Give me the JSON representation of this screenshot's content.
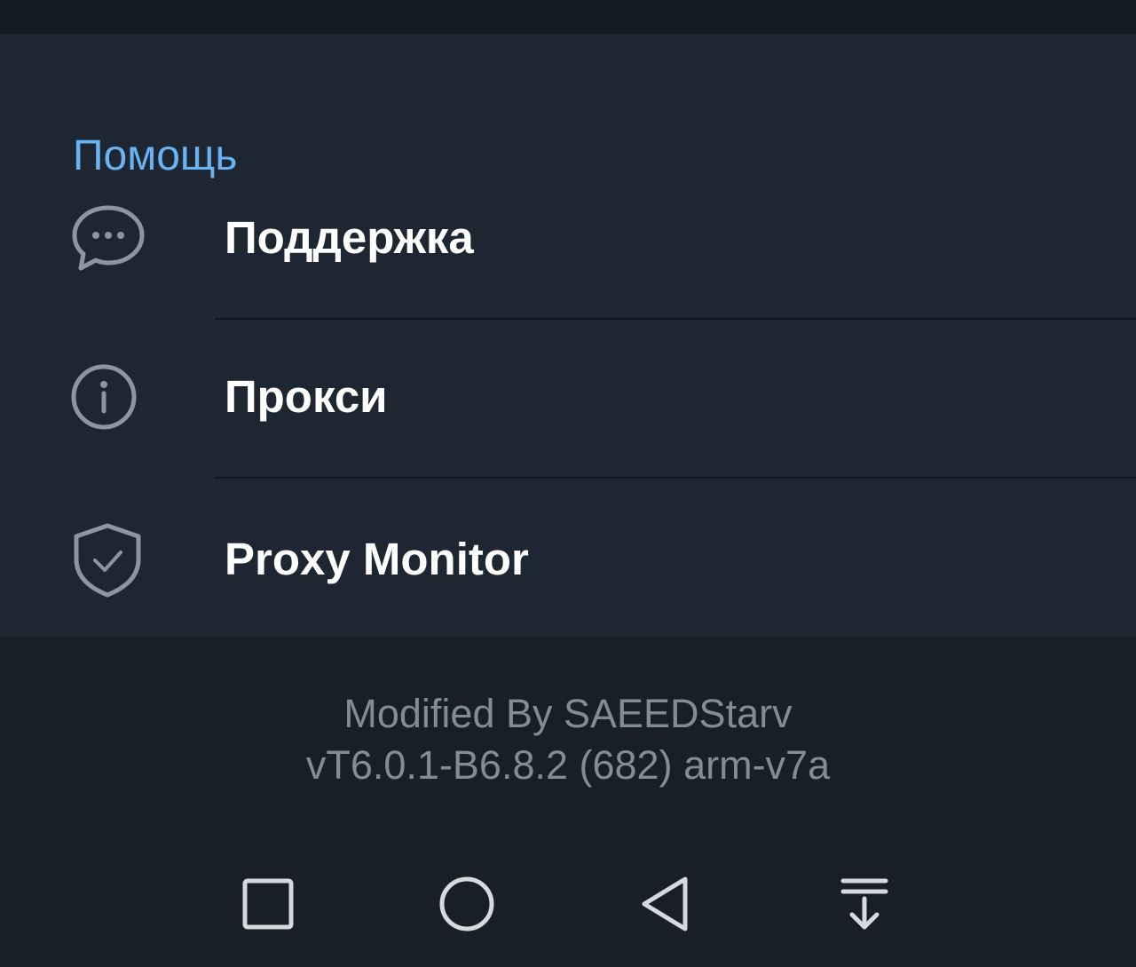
{
  "section": {
    "header": "Помощь",
    "items": [
      {
        "label": "Поддержка",
        "icon": "chat-bubble-icon"
      },
      {
        "label": "Прокси",
        "icon": "info-icon"
      },
      {
        "label": "Proxy Monitor",
        "icon": "shield-check-icon"
      }
    ]
  },
  "footer": {
    "modified_by": "Modified By SAEEDStarv",
    "version": "vT6.0.1-B6.8.2 (682) arm-v7a"
  },
  "navbar": {
    "buttons": [
      "recent-apps-icon",
      "home-icon",
      "back-icon",
      "notification-pulldown-icon"
    ]
  },
  "colors": {
    "accent": "#6ab3f3",
    "section_bg": "#1d2631",
    "screen_bg": "#181f27",
    "text_primary": "#ffffff",
    "text_secondary": "#828c97",
    "icon": "#8c96a1"
  }
}
